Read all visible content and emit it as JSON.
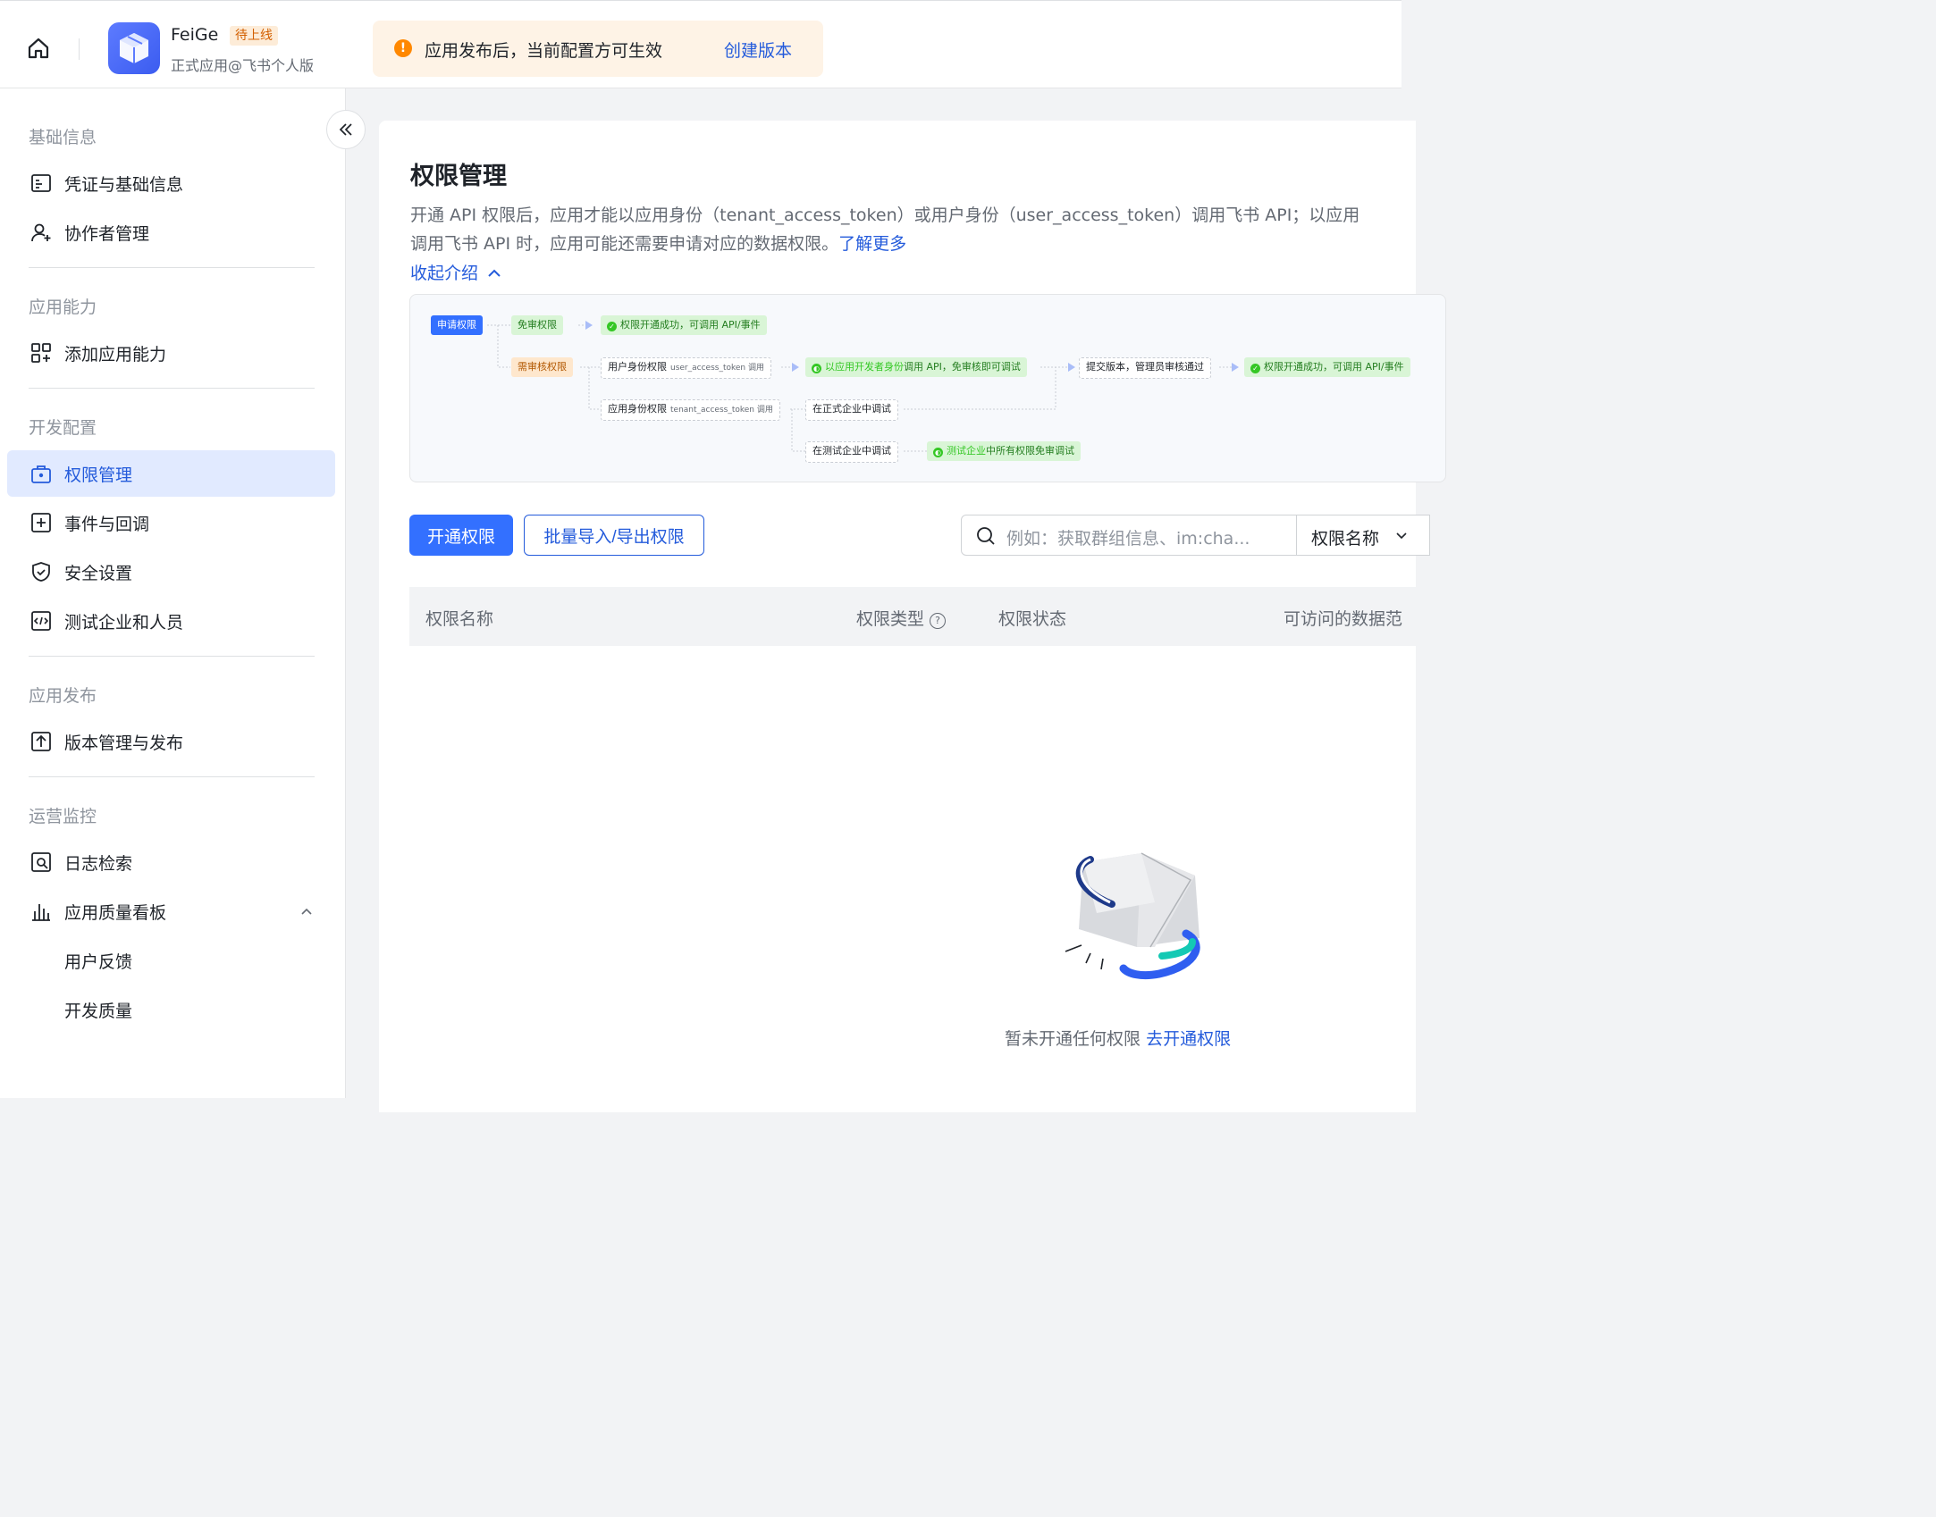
{
  "topbar": {
    "app_name": "FeiGe",
    "app_badge": "待上线",
    "app_subtitle": "正式应用@飞书个人版",
    "notice_message": "应用发布后，当前配置方可生效",
    "notice_link": "创建版本"
  },
  "sidebar": {
    "sections": {
      "basic": "基础信息",
      "ability": "应用能力",
      "dev": "开发配置",
      "release": "应用发布",
      "ops": "运营监控"
    },
    "items": {
      "credentials": "凭证与基础信息",
      "collaborators": "协作者管理",
      "add_ability": "添加应用能力",
      "permissions": "权限管理",
      "events": "事件与回调",
      "security": "安全设置",
      "test_tenant": "测试企业和人员",
      "versions": "版本管理与发布",
      "logs": "日志检索",
      "quality_board": "应用质量看板",
      "feedback": "用户反馈",
      "dev_quality": "开发质量"
    }
  },
  "main": {
    "title": "权限管理",
    "desc_line1": "开通 API 权限后，应用才能以应用身份（tenant_access_token）或用户身份（user_access_token）调用飞书 API；以应用",
    "desc_line2": "调用飞书 API 时，应用可能还需要申请对应的数据权限。",
    "learn_more": "了解更多",
    "collapse_intro": "收起介绍",
    "flow": {
      "apply": "申请权限",
      "exempt": "免审权限",
      "success1": "权限开通成功，可调用 API/事件",
      "review": "需审核权限",
      "user_perm": "用户身份权限",
      "user_token": "user_access_token 调用",
      "dev_identity_hl": "以应用开发者身份",
      "dev_identity_rest": "调用 API，免审核即可调试",
      "submit": "提交版本，管理员审核通过",
      "success2": "权限开通成功，可调用 API/事件",
      "app_perm": "应用身份权限",
      "tenant_token": "tenant_access_token 调用",
      "prod_debug": "在正式企业中调试",
      "test_debug": "在测试企业中调试",
      "test_all_hl": "测试企业",
      "test_all_rest": "中所有权限免审调试"
    },
    "btn_open": "开通权限",
    "btn_batch": "批量导入/导出权限",
    "search_placeholder": "例如：获取群组信息、im:cha...",
    "select_value": "权限名称",
    "columns": {
      "name": "权限名称",
      "type": "权限类型",
      "status": "权限状态",
      "scope": "可访问的数据范"
    },
    "empty_text": "暂未开通任何权限",
    "empty_link": "去开通权限"
  },
  "colors": {
    "primary": "#3370ff",
    "link": "#245bdb",
    "active_bg": "#e1eaff",
    "notice_bg": "#fef3e6",
    "warning": "#ff8800"
  }
}
